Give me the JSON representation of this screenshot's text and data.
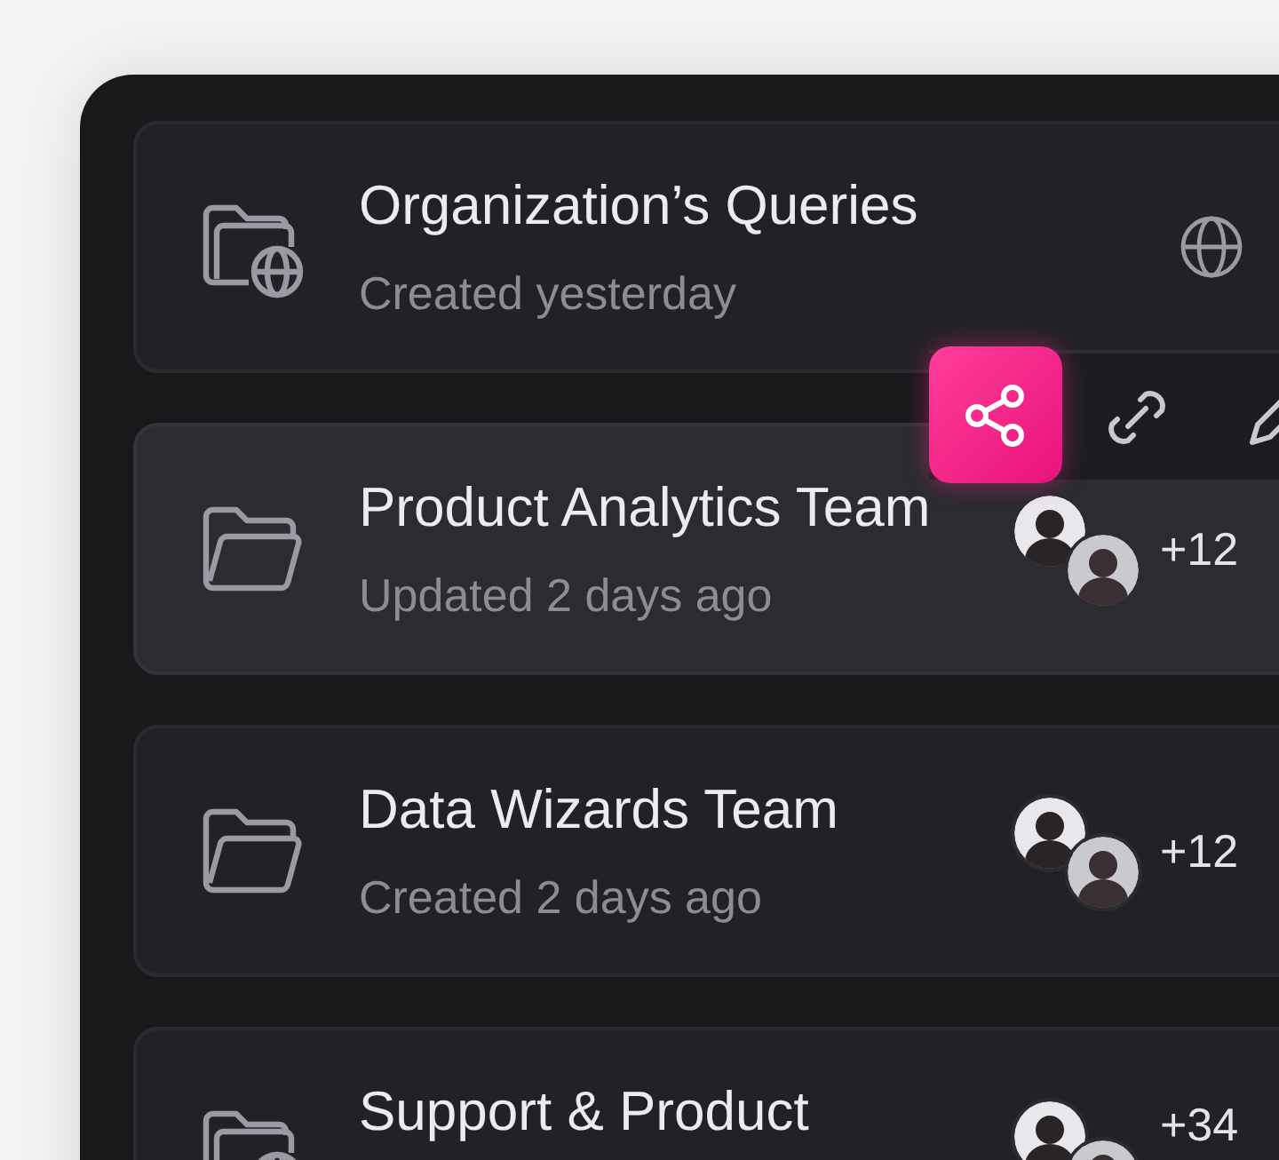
{
  "folders": [
    {
      "title": "Organization’s Queries",
      "subtitle": "Created yesterday",
      "kind": "shared",
      "selected": false,
      "trailing": {
        "kind": "globe"
      }
    },
    {
      "title": "Product Analytics Team",
      "subtitle": "Updated 2 days ago",
      "kind": "private",
      "selected": true,
      "trailing": {
        "kind": "members",
        "count": "+12"
      }
    },
    {
      "title": "Data Wizards Team",
      "subtitle": "Created 2 days ago",
      "kind": "private",
      "selected": false,
      "trailing": {
        "kind": "members",
        "count": "+12"
      }
    },
    {
      "title": "Support & Product",
      "kind": "shared",
      "selected": false,
      "trailing": {
        "kind": "members",
        "count": "+34"
      }
    }
  ],
  "toolbar": [
    {
      "kind": "share",
      "selected": true
    },
    {
      "kind": "link",
      "selected": false
    },
    {
      "kind": "pen",
      "selected": false
    }
  ]
}
